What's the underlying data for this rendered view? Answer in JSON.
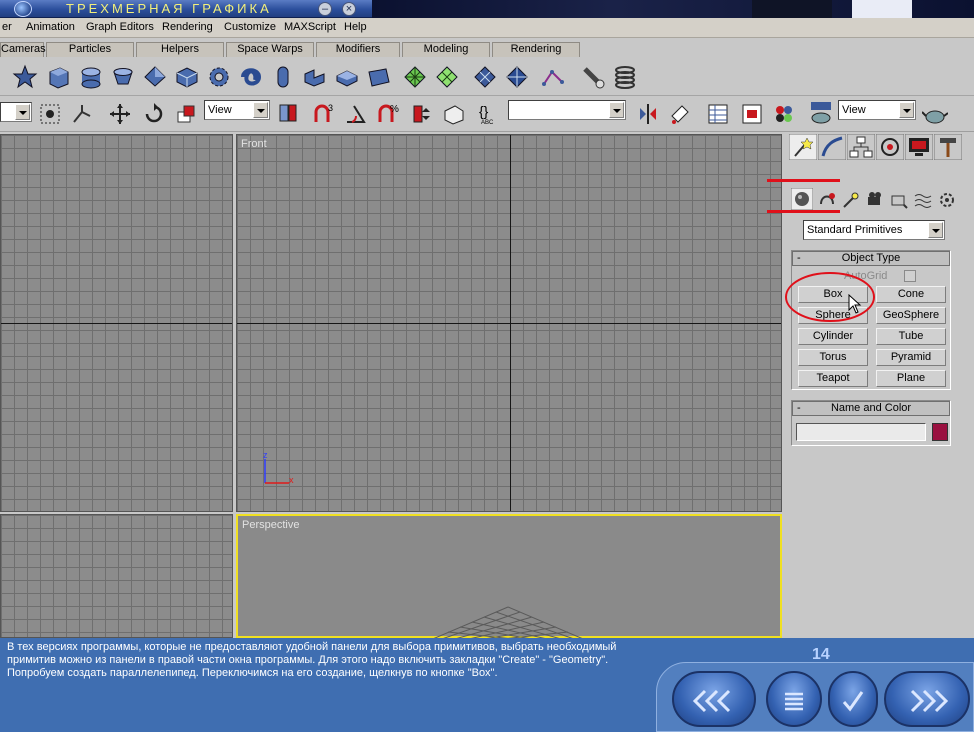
{
  "window": {
    "title": "ТРЕХМЕРНАЯ ГРАФИКА",
    "minimize_glyph": "–",
    "close_glyph": "×"
  },
  "menubar": {
    "items": [
      "er",
      "Animation",
      "Graph Editors",
      "Rendering",
      "Customize",
      "MAXScript",
      "Help"
    ]
  },
  "tabs": [
    "Cameras",
    "Particles",
    "Helpers",
    "Space Warps",
    "Modifiers",
    "Modeling",
    "Rendering"
  ],
  "toolbar": {
    "view_combo": "View",
    "view_combo_right": "View",
    "named_selection": ""
  },
  "viewports": {
    "front_label": "Front",
    "perspective_label": "Perspective",
    "axis_z": "z",
    "axis_x": "x"
  },
  "command_panel": {
    "category_dropdown": "Standard Primitives",
    "object_type": {
      "title": "Object Type",
      "collapse_glyph": "-",
      "autogrid_label": "AutoGrid",
      "buttons": [
        "Box",
        "Cone",
        "Sphere",
        "GeoSphere",
        "Cylinder",
        "Tube",
        "Torus",
        "Pyramid",
        "Teapot",
        "Plane"
      ]
    },
    "name_and_color": {
      "title": "Name and Color",
      "collapse_glyph": "-",
      "name_value": "",
      "color": "#9a1040"
    }
  },
  "lesson": {
    "caption": "В тех версиях программы, которые не предоставляют удобной панели для выбора примитивов, выбрать необходимый примитив можно из панели в правой части окна программы. Для этого надо включить закладки \"Create\" - \"Geometry\".  Попробуем создать параллелепипед. Переключимся на его создание, щелкнув по кнопке \"Box\".",
    "page_number": "14"
  },
  "colors": {
    "highlight_ellipse": "#e0101a",
    "active_viewport_border": "#f0e020",
    "caption_panel": "#3f6eb1"
  },
  "icons": [
    "back-arrows-icon",
    "menu-lines-icon",
    "checkmark-icon",
    "forward-arrows-icon"
  ]
}
